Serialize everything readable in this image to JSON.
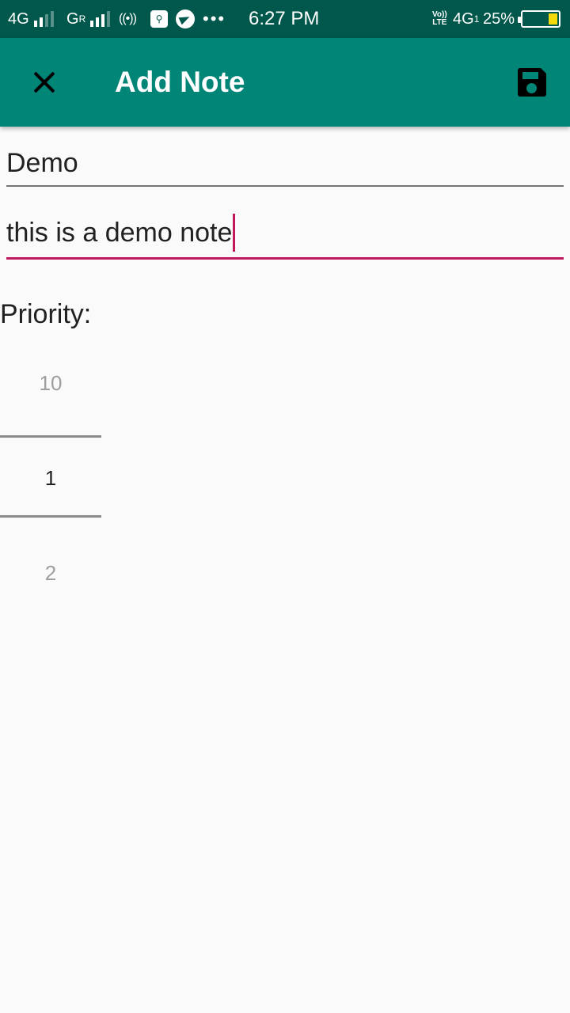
{
  "status_bar": {
    "network1": "4G",
    "network2": "G",
    "network2_sup": "R",
    "hotspot": "((•))",
    "usb_icon": "usb-icon",
    "more": "•••",
    "time": "6:27 PM",
    "volte_top": "Vo))",
    "volte_bottom": "LTE",
    "network3": "4G",
    "network3_sub": "1",
    "battery_percent": "25%",
    "battery_level": 0.25,
    "battery_fill_color": "#f5d90a"
  },
  "app_bar": {
    "title": "Add Note",
    "close_icon": "close-icon",
    "save_icon": "floppy-disk-icon",
    "background": "#008577"
  },
  "form": {
    "title_value": "Demo",
    "description_value": "this is a demo note",
    "accent_color": "#c2185b",
    "priority_label": "Priority:",
    "priority_picker": {
      "previous": "10",
      "selected": "1",
      "next": "2"
    }
  }
}
